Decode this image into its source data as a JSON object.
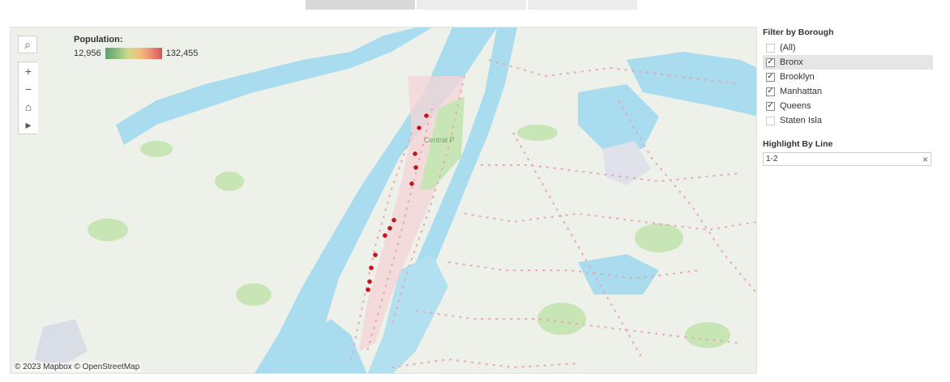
{
  "legend": {
    "title": "Population:",
    "min": "12,956",
    "max": "132,455"
  },
  "attribution": "© 2023 Mapbox  © OpenStreetMap",
  "map_label": "Central P",
  "filter": {
    "title": "Filter by Borough",
    "options": [
      {
        "label": "(All)",
        "checked": false
      },
      {
        "label": "Bronx",
        "checked": true
      },
      {
        "label": "Brooklyn",
        "checked": true
      },
      {
        "label": "Manhattan",
        "checked": true
      },
      {
        "label": "Queens",
        "checked": true
      },
      {
        "label": "Staten Isla",
        "checked": false
      }
    ]
  },
  "highlight": {
    "title": "Highlight By Line",
    "value": "1-2"
  },
  "controls": [
    "search-icon",
    "zoom-in-icon",
    "zoom-out-icon",
    "home-icon",
    "play-icon"
  ],
  "colors": {
    "water": "#a9dcef",
    "park": "#c8e6b5",
    "station": "#c4161c",
    "route": "#e8a3ad"
  }
}
